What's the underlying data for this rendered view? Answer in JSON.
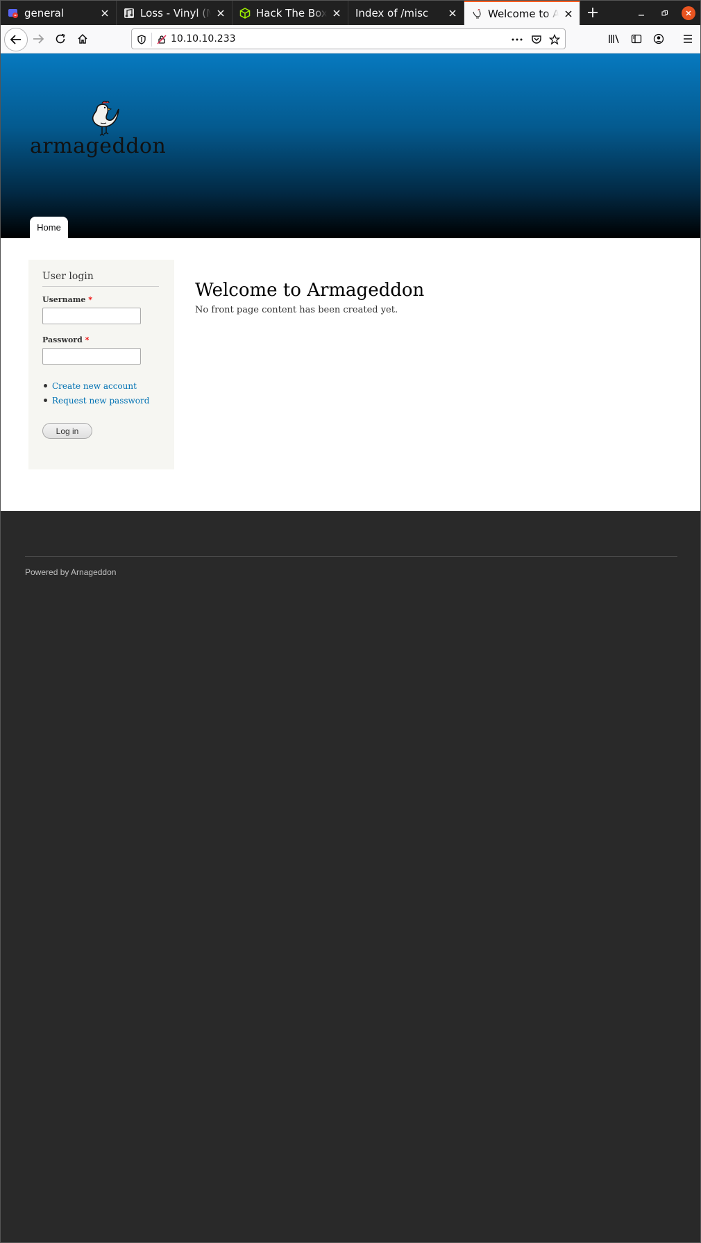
{
  "browser": {
    "tabs": [
      {
        "title": "general",
        "icon": "chat-app-icon",
        "active": false
      },
      {
        "title": "Loss - Vinyl (Mir",
        "icon": "music-note-icon",
        "active": false
      },
      {
        "title": "Hack The Box :: H",
        "icon": "cube-icon",
        "active": false
      },
      {
        "title": "Index of /misc",
        "icon": "none",
        "active": false
      },
      {
        "title": "Welcome to Arm",
        "icon": "chicken-icon",
        "active": true
      }
    ],
    "url": "10.10.10.233",
    "accent_color": "#ff5c20"
  },
  "site": {
    "logo_text": "armageddon",
    "nav": {
      "home_label": "Home"
    },
    "header_gradient": [
      "#0779bf",
      "#000000"
    ]
  },
  "login_block": {
    "title": "User login",
    "username_label": "Username",
    "password_label": "Password",
    "required_marker": "*",
    "username_value": "",
    "password_value": "",
    "links": [
      "Create new account",
      "Request new password"
    ],
    "submit_label": "Log in"
  },
  "main": {
    "title": "Welcome to Armageddon",
    "body": "No front page content has been created yet."
  },
  "footer": {
    "text": "Powered by Arnageddon"
  }
}
